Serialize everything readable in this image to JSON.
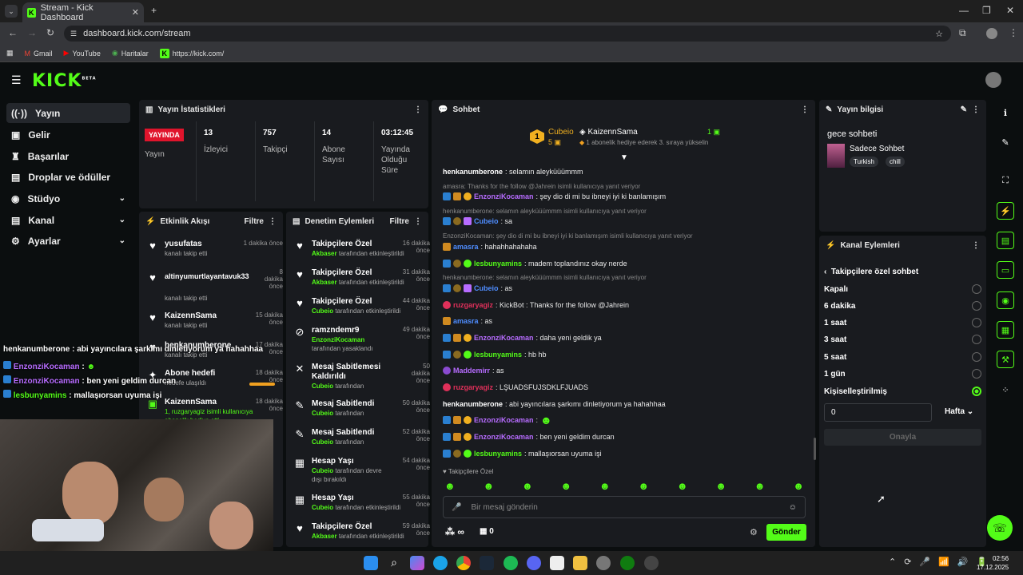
{
  "browser": {
    "tab_title": "Stream - Kick Dashboard",
    "url": "dashboard.kick.com/stream",
    "bookmarks": [
      "Gmail",
      "YouTube",
      "Haritalar",
      "https://kick.com/"
    ]
  },
  "brand": {
    "logo": "KICK",
    "beta": "BETA",
    "accent": "#53fc18"
  },
  "sidebar": {
    "items": [
      {
        "label": "Yayın",
        "icon": "broadcast-icon"
      },
      {
        "label": "Gelir",
        "icon": "revenue-icon"
      },
      {
        "label": "Başarılar",
        "icon": "trophy-icon"
      },
      {
        "label": "Droplar ve ödüller",
        "icon": "gift-icon"
      },
      {
        "label": "Stüdyo",
        "icon": "studio-icon"
      },
      {
        "label": "Kanal",
        "icon": "channel-icon"
      },
      {
        "label": "Ayarlar",
        "icon": "gear-icon"
      }
    ]
  },
  "stats": {
    "title": "Yayın İstatistikleri",
    "live_badge": "YAYINDA",
    "items": [
      {
        "value": "",
        "label": "Yayın"
      },
      {
        "value": "13",
        "label": "İzleyici"
      },
      {
        "value": "757",
        "label": "Takipçi"
      },
      {
        "value": "14",
        "label": "Abone Sayısı"
      },
      {
        "value": "03:12:45",
        "label": "Yayında Olduğu Süre"
      }
    ]
  },
  "activity": {
    "title": "Etkinlik Akışı",
    "filter": "Filtre",
    "items": [
      {
        "name": "yusufatas",
        "sub": "kanalı takip etti",
        "time": "1 dakika önce"
      },
      {
        "name": "altinyumurtlayantavuk33",
        "sub": "kanalı takip etti",
        "time": "8 dakika önce"
      },
      {
        "name": "KaizennSama",
        "sub": "kanalı takip etti",
        "time": "15 dakika önce"
      },
      {
        "name": "henkanumberone",
        "sub": "kanalı takip etti",
        "time": "17 dakika önce"
      },
      {
        "name": "Abone hedefi",
        "sub": "hedefe ulaşıldı",
        "time": "18 dakika önce"
      },
      {
        "name": "KaizennSama",
        "sub": "1, ruzgaryagiz isimli kullanıcıya abonelik hediye etti",
        "time": "18 dakika önce"
      }
    ]
  },
  "moderation": {
    "title": "Denetim Eylemleri",
    "filter": "Filtre",
    "items": [
      {
        "title": "Takipçilere Özel",
        "who": "Akbaser",
        "sub": "tarafından etkinleştirildi",
        "time": "16 dakika önce"
      },
      {
        "title": "Takipçilere Özel",
        "who": "Akbaser",
        "sub": "tarafından etkinleştirildi",
        "time": "31 dakika önce"
      },
      {
        "title": "Takipçilere Özel",
        "who": "Cubeio",
        "sub": "tarafından etkinleştirildi",
        "time": "44 dakika önce"
      },
      {
        "title": "ramzndemr9",
        "who": "EnzonziKocaman",
        "sub": "tarafından yasaklandı",
        "time": "49 dakika önce"
      },
      {
        "title": "Mesaj Sabitlemesi Kaldırıldı",
        "who": "Cubeio",
        "sub": "tarafından",
        "time": "50 dakika önce"
      },
      {
        "title": "Mesaj Sabitlendi",
        "who": "Cubeio",
        "sub": "tarafından",
        "time": "50 dakika önce"
      },
      {
        "title": "Mesaj Sabitlendi",
        "who": "Cubeio",
        "sub": "tarafından",
        "time": "52 dakika önce"
      },
      {
        "title": "Hesap Yaşı",
        "who": "Cubeio",
        "sub": "tarafından devre dışı bırakıldı",
        "time": "54 dakika önce"
      },
      {
        "title": "Hesap Yaşı",
        "who": "Cubeio",
        "sub": "tarafından etkinleştirildi",
        "time": "55 dakika önce"
      },
      {
        "title": "Takipçilere Özel",
        "who": "Akbaser",
        "sub": "tarafından etkinleştirildi",
        "time": "59 dakika önce"
      }
    ]
  },
  "chat": {
    "title": "Sohbet",
    "leader": {
      "rank": "1",
      "name": "Cubeio",
      "count": "5"
    },
    "gifter": {
      "name": "KaizennSama",
      "count": "1",
      "note": "1 abonelik hediye ederek 3. sıraya yükselin"
    },
    "messages": [
      {
        "user": "henkanumberone",
        "color": "#ffffff",
        "text": ": selamın aleyküüümmm"
      },
      {
        "reply": "amasra: Thanks for the follow @Jahrein isimli kullanıcıya yanıt veriyor"
      },
      {
        "user": "EnzonziKocaman",
        "color": "#b76cff",
        "text": ": şey dio di mi bu ibneyi iyi ki banlamışım"
      },
      {
        "reply": "henkanumberone: selamın aleyküüümmm isimli kullanıcıya yanıt veriyor"
      },
      {
        "user": "Cubeio",
        "color": "#4f8dff",
        "text": ": sa"
      },
      {
        "reply": "EnzonziKocaman: şey dio di mi bu ibneyi iyi ki banlamışım isimli kullanıcıya yanıt veriyor"
      },
      {
        "user": "amasra",
        "color": "#4f8dff",
        "text": ": hahahhahahaha"
      },
      {
        "user": "lesbunyamins",
        "color": "#53fc18",
        "text": ": madem toplandınız okay nerde"
      },
      {
        "reply": "henkanumberone: selamın aleyküüümmm isimli kullanıcıya yanıt veriyor"
      },
      {
        "user": "Cubeio",
        "color": "#4f8dff",
        "text": ": as"
      },
      {
        "user": "ruzgaryagiz",
        "color": "#e0305a",
        "text": ": KickBot : Thanks for the follow @Jahrein"
      },
      {
        "user": "amasra",
        "color": "#4f8dff",
        "text": ": as"
      },
      {
        "user": "EnzonziKocaman",
        "color": "#b76cff",
        "text": ": daha yeni geldik ya"
      },
      {
        "user": "lesbunyamins",
        "color": "#53fc18",
        "text": ": hb hb"
      },
      {
        "user": "Maddemirr",
        "color": "#b76cff",
        "text": ": as"
      },
      {
        "user": "ruzgaryagiz",
        "color": "#e0305a",
        "text": ": LŞUADSFUJSDKLFJUADS"
      },
      {
        "user": "henkanumberone",
        "color": "#ffffff",
        "text": ": abi yayıncılara şarkımı dinletiyorum ya hahahhaa"
      },
      {
        "user": "EnzonziKocaman",
        "color": "#b76cff",
        "text": ":"
      },
      {
        "user": "EnzonziKocaman",
        "color": "#b76cff",
        "text": ": ben yeni geldim durcan"
      },
      {
        "user": "lesbunyamins",
        "color": "#53fc18",
        "text": ": mallaşıorsan uyuma işi"
      }
    ],
    "followers_only": "Takipçilere Özel",
    "input_placeholder": "Bir mesaj gönderin",
    "infinity": "∞",
    "points": "0",
    "send": "Gönder"
  },
  "stream_info": {
    "title": "Yayın bilgisi",
    "stream_title": "gece sohbeti",
    "category": "Sadece Sohbet",
    "tags": [
      "Turkish",
      "chill"
    ]
  },
  "channel_actions": {
    "title": "Kanal Eylemleri",
    "sub_title": "Takipçilere özel sohbet",
    "options": [
      "Kapalı",
      "6 dakika",
      "1 saat",
      "3 saat",
      "5 saat",
      "1 gün",
      "Kişiselleştirilmiş"
    ],
    "selected": "Kişiselleştirilmiş",
    "custom_value": "0",
    "unit": "Hafta",
    "confirm": "Onayla"
  },
  "overlay_chat": [
    {
      "user": "henkanumberone",
      "text": " : abi yayıncılara şarkımı dinletiyorum ya hahahhaa"
    },
    {
      "user": "EnzonziKocaman",
      "text": " :"
    },
    {
      "user": "EnzonziKocaman",
      "text": " : ben yeni geldim durcan"
    },
    {
      "user": "lesbunyamins",
      "text": " : mallaşıorsan uyuma işi"
    }
  ],
  "taskbar": {
    "time": "02:56",
    "date": "17.12.2025"
  }
}
